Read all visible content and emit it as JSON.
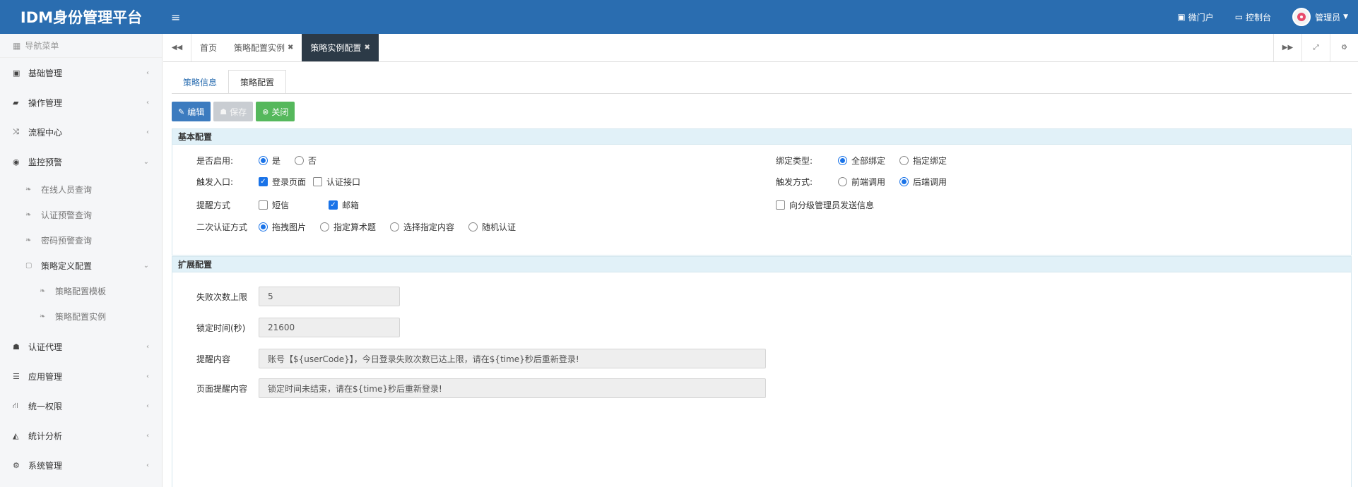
{
  "header": {
    "brand": "IDM身份管理平台",
    "portal": "微门户",
    "console": "控制台",
    "user": "管理员"
  },
  "sidebar": {
    "title": "导航菜单",
    "items": [
      {
        "label": "基础管理"
      },
      {
        "label": "操作管理"
      },
      {
        "label": "流程中心"
      },
      {
        "label": "监控预警"
      }
    ],
    "monitor_sub": [
      {
        "label": "在线人员查询"
      },
      {
        "label": "认证预警查询"
      },
      {
        "label": "密码预警查询"
      }
    ],
    "strategy_group": "策略定义配置",
    "strategy_sub": [
      {
        "label": "策略配置模板"
      },
      {
        "label": "策略配置实例"
      }
    ],
    "bottom_items": [
      {
        "label": "认证代理"
      },
      {
        "label": "应用管理"
      },
      {
        "label": "统一权限"
      },
      {
        "label": "统计分析"
      },
      {
        "label": "系统管理"
      }
    ]
  },
  "tabs": [
    {
      "label": "首页"
    },
    {
      "label": "策略配置实例"
    },
    {
      "label": "策略实例配置"
    }
  ],
  "subtabs": {
    "info": "策略信息",
    "config": "策略配置"
  },
  "toolbar": {
    "edit": "编辑",
    "save": "保存",
    "close": "关闭"
  },
  "basic": {
    "title": "基本配置",
    "enable_label": "是否启用:",
    "enable_yes": "是",
    "enable_no": "否",
    "bind_label": "绑定类型:",
    "bind_all": "全部绑定",
    "bind_specific": "指定绑定",
    "entry_label": "触发入口:",
    "entry_login": "登录页面",
    "entry_api": "认证接口",
    "trigger_label": "触发方式:",
    "trigger_front": "前端调用",
    "trigger_back": "后端调用",
    "remind_label": "提醒方式",
    "remind_sms": "短信",
    "remind_mail": "邮箱",
    "notify_admin": "向分级管理员发送信息",
    "second_label": "二次认证方式",
    "second_drag": "拖拽图片",
    "second_math": "指定算术题",
    "second_select": "选择指定内容",
    "second_random": "随机认证"
  },
  "ext": {
    "title": "扩展配置",
    "fail_label": "失败次数上限",
    "fail_value": "5",
    "lock_label": "锁定时间(秒)",
    "lock_value": "21600",
    "remind_label": "提醒内容",
    "remind_value": "账号【${userCode}】，今日登录失败次数已达上限，请在${time}秒后重新登录!",
    "page_label": "页面提醒内容",
    "page_value": "锁定时间未结束，请在${time}秒后重新登录!"
  },
  "colors": {
    "header": "#2a6db0",
    "active_tab": "#2c3a47",
    "edit_btn": "#3c7bbf",
    "close_btn": "#55b85c",
    "panel_head": "#e1f1f8"
  }
}
